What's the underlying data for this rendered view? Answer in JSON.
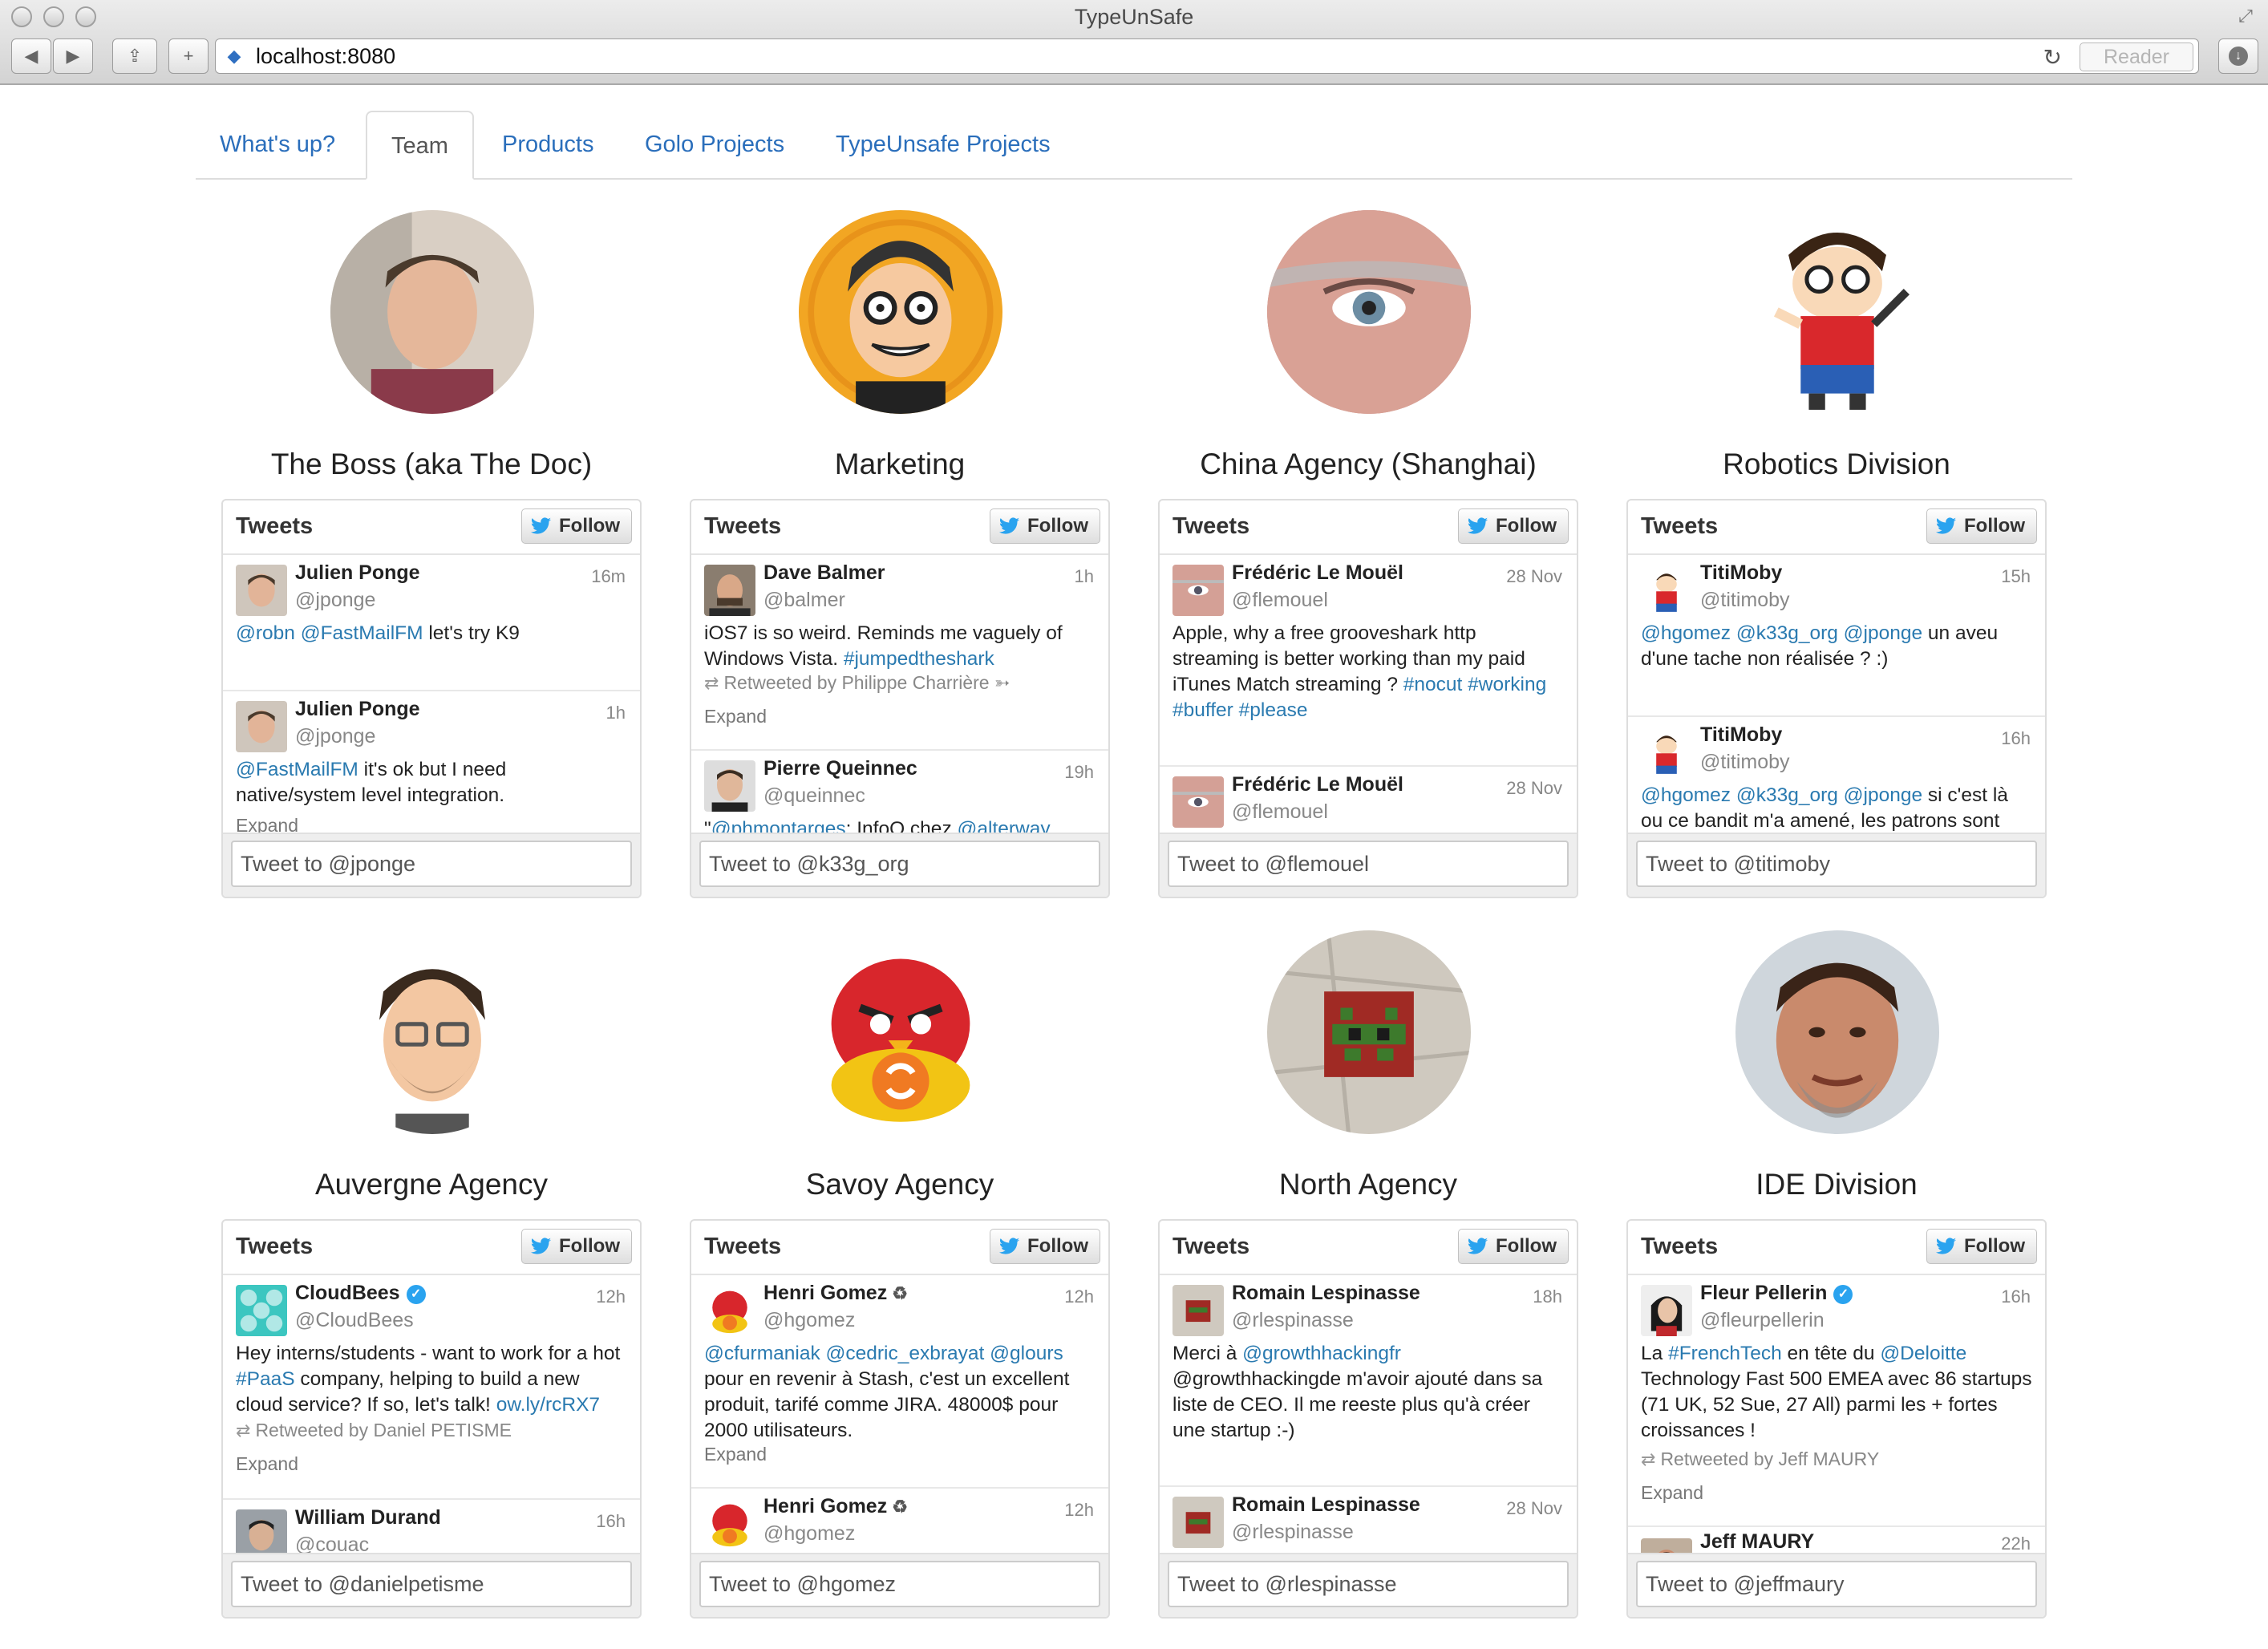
{
  "browser": {
    "window_title": "TypeUnSafe",
    "url": "localhost:8080",
    "reader_label": "Reader"
  },
  "tabs": [
    {
      "label": "What's up?",
      "active": false
    },
    {
      "label": "Team",
      "active": true
    },
    {
      "label": "Products",
      "active": false
    },
    {
      "label": "Golo Projects",
      "active": false
    },
    {
      "label": "TypeUnsafe Projects",
      "active": false
    }
  ],
  "widget_common": {
    "header": "Tweets",
    "follow_label": "Follow",
    "expand_label": "Expand"
  },
  "members": [
    {
      "name": "The Boss (aka The Doc)",
      "compose_placeholder": "Tweet to @jponge",
      "tweets": [
        {
          "user": "Julien Ponge",
          "handle": "@jponge",
          "time": "16m",
          "text_links": "@robn @FastMailFM",
          "text_rest": " let's try K9"
        },
        {
          "user": "Julien Ponge",
          "handle": "@jponge",
          "time": "1h",
          "text_links": "@FastMailFM",
          "text_rest": " it's ok but I need native/system level integration.",
          "expand": "Expand"
        }
      ]
    },
    {
      "name": "Marketing",
      "compose_placeholder": "Tweet to @k33g_org",
      "tweets": [
        {
          "user": "Dave Balmer",
          "handle": "@balmer",
          "time": "1h",
          "text_plain": "iOS7 is so weird. Reminds me vaguely of Windows Vista. ",
          "text_link": "#jumpedtheshark",
          "retweeted_by": "Retweeted by Philippe Charrière ➳",
          "expand": "Expand"
        },
        {
          "user": "Pierre Queinnec",
          "handle": "@queinnec",
          "time": "19h",
          "text_plain": "\"",
          "text_link": "@phmontarges",
          "text_rest": ": InfoQ chez ",
          "text_link2": "@alterway"
        }
      ]
    },
    {
      "name": "China Agency (Shanghai)",
      "compose_placeholder": "Tweet to @flemouel",
      "tweets": [
        {
          "user": "Frédéric Le Mouël",
          "handle": "@flemouel",
          "time": "28 Nov",
          "text_plain": "Apple, why a free grooveshark http streaming is better working than my paid iTunes Match streaming ? ",
          "text_link": "#nocut #working #buffer #please"
        },
        {
          "user": "Frédéric Le Mouël",
          "handle": "@flemouel",
          "time": "28 Nov"
        }
      ]
    },
    {
      "name": "Robotics Division",
      "compose_placeholder": "Tweet to @titimoby",
      "tweets": [
        {
          "user": "TitiMoby",
          "handle": "@titimoby",
          "time": "15h",
          "text_links": "@hgomez @k33g_org @jponge",
          "text_rest": " un aveu d'une tache non réalisée ? :)"
        },
        {
          "user": "TitiMoby",
          "handle": "@titimoby",
          "time": "16h",
          "text_links": "@hgomez @k33g_org @jponge",
          "text_rest": " si c'est là ou ce bandit m'a amené, les patrons sont aussi"
        }
      ]
    },
    {
      "name": "Auvergne Agency",
      "compose_placeholder": "Tweet to @danielpetisme",
      "tweets": [
        {
          "user": "CloudBees",
          "handle": "@CloudBees",
          "time": "12h",
          "text_plain": "Hey interns/students - want to work for a hot ",
          "text_link": "#PaaS",
          "text_rest": " company, helping to build a new cloud service? If so, let's talk! ",
          "text_link2": "ow.ly/rcRX7",
          "retweeted_by": "Retweeted by Daniel PETISME",
          "expand": "Expand"
        },
        {
          "user": "William Durand",
          "handle": "@couac",
          "time": "16h"
        }
      ]
    },
    {
      "name": "Savoy Agency",
      "compose_placeholder": "Tweet to @hgomez",
      "tweets": [
        {
          "user": "Henri Gomez",
          "handle": "@hgomez",
          "time": "12h",
          "text_links": "@cfurmaniak @cedric_exbrayat @glours",
          "text_rest": " pour en revenir à Stash, c'est un excellent produit, tarifé comme JIRA. 48000$ pour 2000 utilisateurs.",
          "expand": "Expand"
        },
        {
          "user": "Henri Gomez",
          "handle": "@hgomez",
          "time": "12h"
        }
      ]
    },
    {
      "name": "North Agency",
      "compose_placeholder": "Tweet to @rlespinasse",
      "tweets": [
        {
          "user": "Romain Lespinasse",
          "handle": "@rlespinasse",
          "time": "18h",
          "text_plain": "Merci à ",
          "text_link": "@growthhackingfr",
          "text_rest": " @growthhackingde m'avoir ajouté dans sa liste de CEO. Il me reeste plus qu'à créer une startup :-)"
        },
        {
          "user": "Romain Lespinasse",
          "handle": "@rlespinasse",
          "time": "28 Nov"
        }
      ]
    },
    {
      "name": "IDE Division",
      "compose_placeholder": "Tweet to @jeffmaury",
      "tweets": [
        {
          "user": "Fleur Pellerin",
          "handle": "@fleurpellerin",
          "time": "16h",
          "text_plain": "La ",
          "text_link": "#FrenchTech",
          "text_rest": " en tête du ",
          "text_link2": "@Deloitte",
          "text_rest2": " Technology Fast 500 EMEA avec 86 startups (71 UK, 52 Sue, 27 All) parmi les + fortes croissances !",
          "retweeted_by": "Retweeted by Jeff MAURY",
          "expand": "Expand"
        },
        {
          "user": "Jeff MAURY",
          "handle": "",
          "time": "22h"
        }
      ]
    }
  ],
  "colors": {
    "link": "#2a7ab0",
    "tab_link": "#2a6ebb",
    "twitter_blue": "#2aa3ef"
  }
}
